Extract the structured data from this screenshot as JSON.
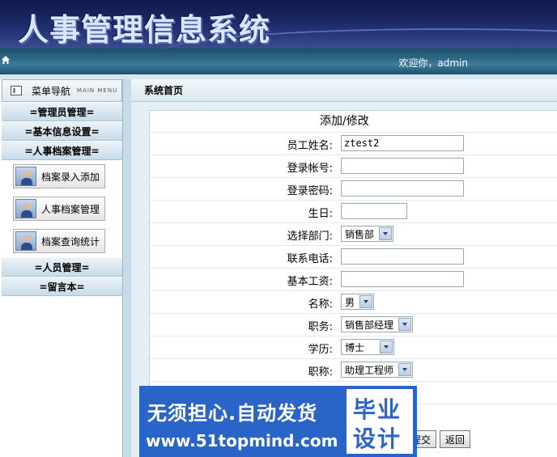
{
  "header": {
    "title": "人事管理信息系统"
  },
  "navbar": {
    "welcome": "欢迎你，admin"
  },
  "sidebar": {
    "menu_title": "菜单导航",
    "menu_en": "MAIN MENU",
    "categories": [
      "=管理员管理=",
      "=基本信息设置=",
      "=人事档案管理="
    ],
    "sub_items": [
      "档案录入添加",
      "人事档案管理",
      "档案查询统计"
    ],
    "categories_after": [
      "=人员管理=",
      "=留言本="
    ]
  },
  "main": {
    "crumb": "系统首页",
    "form_title": "添加/修改",
    "fields": {
      "name_label": "员工姓名:",
      "name_value": "ztest2",
      "account_label": "登录帐号:",
      "account_value": "",
      "password_label": "登录密码:",
      "password_value": "",
      "birthday_label": "生日:",
      "birthday_value": "",
      "department_label": "选择部门:",
      "department_value": "销售部",
      "phone_label": "联系电话:",
      "phone_value": "",
      "salary_label": "基本工资:",
      "salary_value": "",
      "gender_label": "名称:",
      "gender_value": "男",
      "position_label": "职务:",
      "position_value": "销售部经理",
      "education_label": "学历:",
      "education_value": "博士",
      "title_label": "职称:",
      "title_value": "助理工程师"
    },
    "submit_label": "提交",
    "back_label": "返回"
  },
  "banner": {
    "line1": "无须担心.自动发货",
    "line2": "www.51topmind.com",
    "badge_top": "毕业",
    "badge_bottom": "设计"
  }
}
